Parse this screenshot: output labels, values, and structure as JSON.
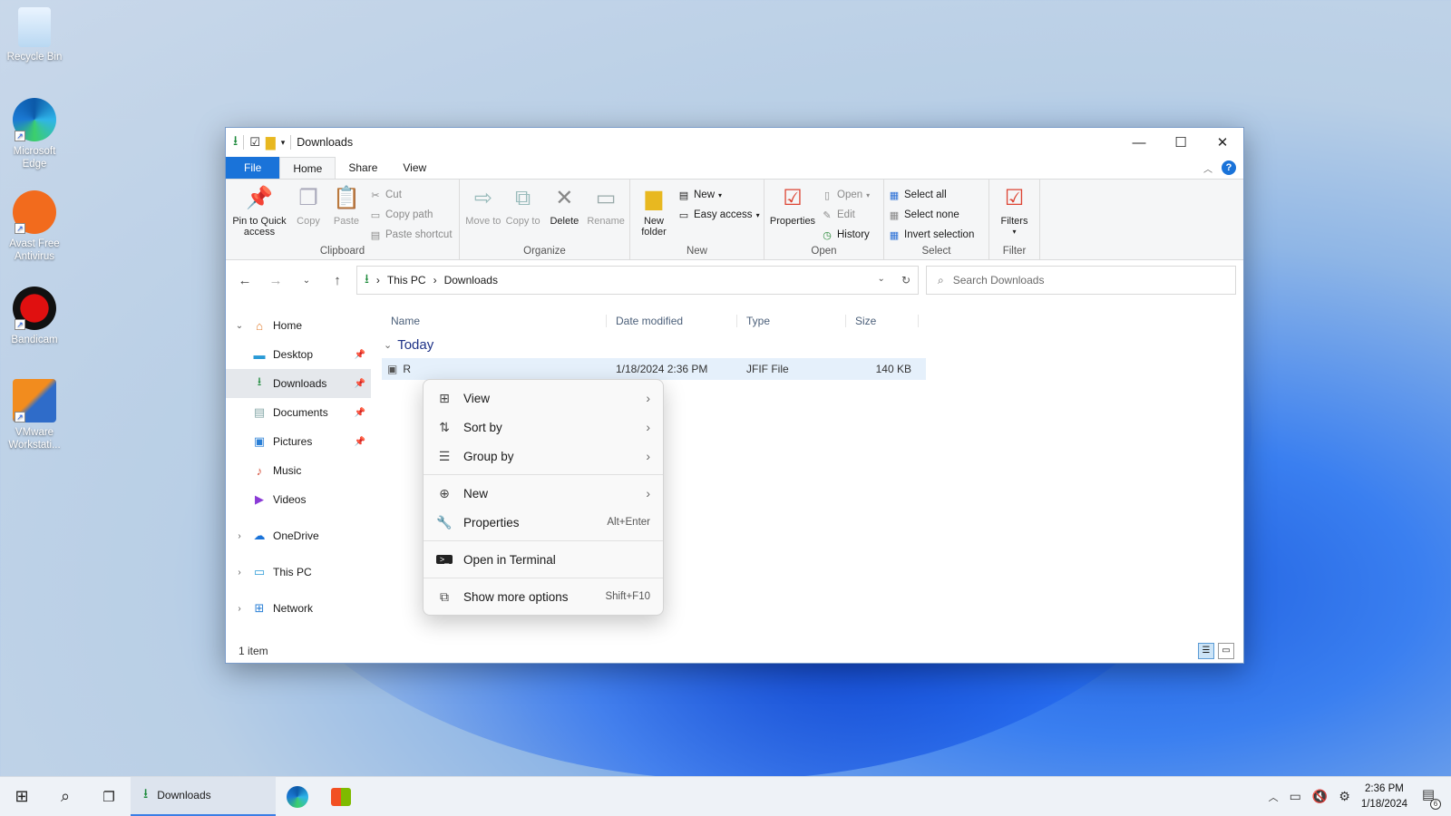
{
  "desktop": {
    "icons": [
      {
        "label": "Recycle Bin"
      },
      {
        "label": "Microsoft Edge"
      },
      {
        "label": "Avast Free Antivirus"
      },
      {
        "label": "Bandicam"
      },
      {
        "label": "VMware Workstati..."
      }
    ]
  },
  "window": {
    "title": "Downloads",
    "tabs": {
      "file": "File",
      "home": "Home",
      "share": "Share",
      "view": "View"
    },
    "ribbon": {
      "clipboard": {
        "label": "Clipboard",
        "pin": "Pin to Quick access",
        "copy": "Copy",
        "paste": "Paste",
        "cut": "Cut",
        "copy_path": "Copy path",
        "paste_shortcut": "Paste shortcut"
      },
      "organize": {
        "label": "Organize",
        "move_to": "Move to",
        "copy_to": "Copy to",
        "delete": "Delete",
        "rename": "Rename"
      },
      "new": {
        "label": "New",
        "new_folder": "New folder",
        "new_item": "New",
        "easy_access": "Easy access"
      },
      "open": {
        "label": "Open",
        "properties": "Properties",
        "open": "Open",
        "edit": "Edit",
        "history": "History"
      },
      "select": {
        "label": "Select",
        "select_all": "Select all",
        "select_none": "Select none",
        "invert": "Invert selection"
      },
      "filter": {
        "label": "Filter",
        "filters": "Filters"
      }
    },
    "address": {
      "crumbs": [
        "This PC",
        "Downloads"
      ],
      "search_placeholder": "Search Downloads"
    },
    "nav": {
      "home": "Home",
      "desktop": "Desktop",
      "downloads": "Downloads",
      "documents": "Documents",
      "pictures": "Pictures",
      "music": "Music",
      "videos": "Videos",
      "onedrive": "OneDrive",
      "thispc": "This PC",
      "network": "Network"
    },
    "columns": {
      "name": "Name",
      "date": "Date modified",
      "type": "Type",
      "size": "Size"
    },
    "group": "Today",
    "file": {
      "name": "R",
      "date": "1/18/2024 2:36 PM",
      "type": "JFIF File",
      "size": "140 KB"
    },
    "status": "1 item"
  },
  "context_menu": {
    "view": "View",
    "sort_by": "Sort by",
    "group_by": "Group by",
    "new": "New",
    "properties": "Properties",
    "properties_shortcut": "Alt+Enter",
    "open_terminal": "Open in Terminal",
    "more_options": "Show more options",
    "more_options_shortcut": "Shift+F10"
  },
  "taskbar": {
    "active_app": "Downloads",
    "time": "2:36 PM",
    "date": "1/18/2024",
    "notification_count": "6"
  },
  "colors": {
    "accent": "#1a73d9",
    "selection": "#e5f0fb",
    "group_header": "#1e3287"
  }
}
